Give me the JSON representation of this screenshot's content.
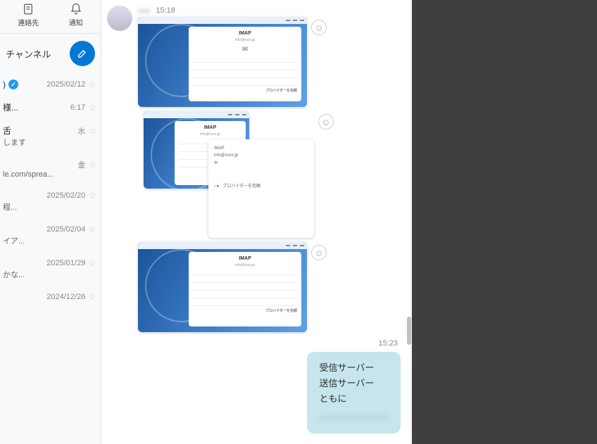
{
  "sidebar": {
    "top_icons": {
      "contacts": "連絡先",
      "notify": "通知"
    },
    "channel_label": "チャンネル",
    "conversations": [
      {
        "name": ")",
        "verified": true,
        "meta": "2025/02/12",
        "sub": ""
      },
      {
        "name": "様...",
        "verified": false,
        "meta": "6:17",
        "sub": ""
      },
      {
        "name": "舌",
        "verified": false,
        "meta": "水",
        "sub": "します"
      },
      {
        "name": "",
        "verified": false,
        "meta": "金",
        "sub": "le.com/sprea..."
      },
      {
        "name": "",
        "verified": false,
        "meta": "2025/02/20",
        "sub": "程..."
      },
      {
        "name": "",
        "verified": false,
        "meta": "2025/02/04",
        "sub": "イア..."
      },
      {
        "name": "",
        "verified": false,
        "meta": "2025/01/29",
        "sub": "かな..."
      },
      {
        "name": "",
        "verified": false,
        "meta": "2024/12/26",
        "sub": ""
      }
    ]
  },
  "chat": {
    "sender_blur": "ww",
    "received_time": "15:18",
    "imap_title": "IMAP",
    "imap_sub_blur": "info@xxxx.jp",
    "sent_time": "15:23",
    "sent_lines": [
      "受信サーバー",
      "送信サーバー",
      "ともに"
    ]
  }
}
